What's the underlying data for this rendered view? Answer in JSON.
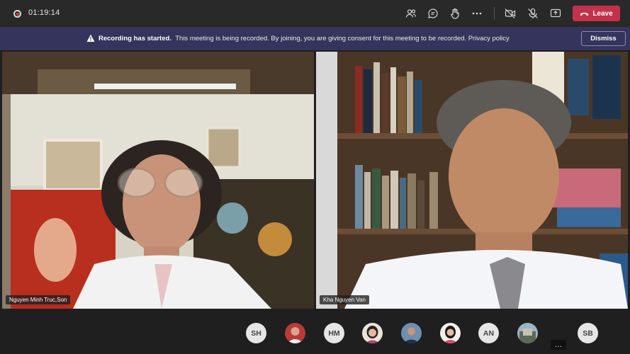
{
  "top_bar": {
    "timer": "01:19:14",
    "leave_label": "Leave"
  },
  "banner": {
    "title": "Recording has started.",
    "message": "This meeting is being recorded. By joining, you are giving consent for this meeting to be recorded.",
    "link": "Privacy policy",
    "dismiss_label": "Dismiss"
  },
  "videos": [
    {
      "name": "Nguyen Minh Truc,Son"
    },
    {
      "name": "Kha Nguyen Van"
    }
  ],
  "participants": [
    {
      "initials": "SH",
      "type": "initials"
    },
    {
      "initials": "",
      "type": "photo"
    },
    {
      "initials": "HM",
      "type": "initials"
    },
    {
      "initials": "",
      "type": "photo"
    },
    {
      "initials": "",
      "type": "photo"
    },
    {
      "initials": "",
      "type": "photo"
    },
    {
      "initials": "AN",
      "type": "initials"
    },
    {
      "initials": "",
      "type": "photo"
    },
    {
      "initials": "SB",
      "type": "initials"
    }
  ],
  "colors": {
    "leave": "#c4314b",
    "banner": "#34345c",
    "topbar": "#292929"
  }
}
